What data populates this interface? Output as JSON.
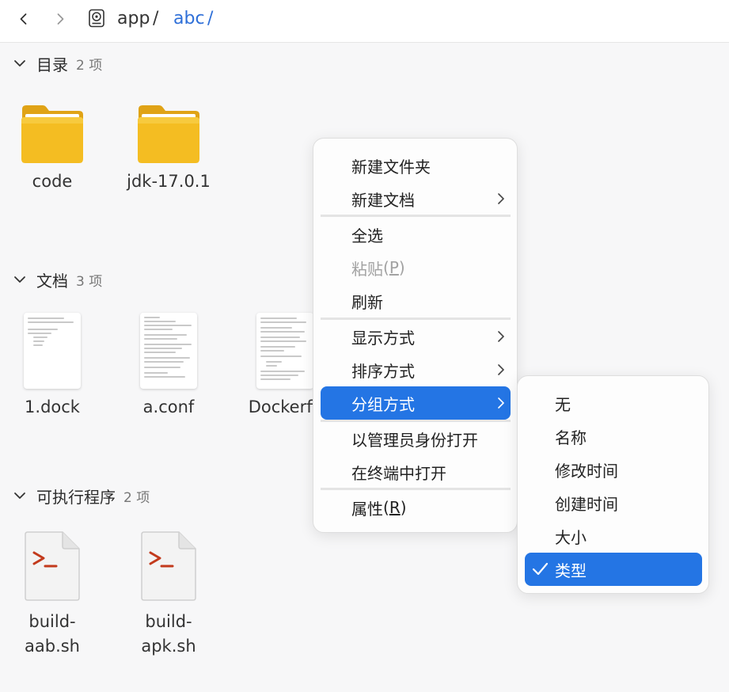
{
  "breadcrumb": {
    "parts": [
      "app",
      "abc"
    ],
    "separator": "/"
  },
  "sections": [
    {
      "title": "目录",
      "count": "2 项",
      "items": [
        "code",
        "jdk-17.0.1"
      ]
    },
    {
      "title": "文档",
      "count": "3 项",
      "items": [
        "1.dock",
        "a.conf",
        "Dockerfil"
      ]
    },
    {
      "title": "可执行程序",
      "count": "2 项",
      "items": [
        "build-\naab.sh",
        "build-\napk.sh"
      ]
    }
  ],
  "context_menu": {
    "new_folder": "新建文件夹",
    "new_document": "新建文档",
    "select_all": "全选",
    "paste": "粘贴",
    "paste_key": "P",
    "refresh": "刷新",
    "view_mode": "显示方式",
    "sort_by": "排序方式",
    "group_by": "分组方式",
    "open_as_admin": "以管理员身份打开",
    "open_in_terminal": "在终端中打开",
    "properties": "属性",
    "properties_key": "R"
  },
  "group_submenu": {
    "items": [
      "无",
      "名称",
      "修改时间",
      "创建时间",
      "大小",
      "类型"
    ],
    "selected": "类型"
  },
  "colors": {
    "accent": "#2475e4",
    "folder": "#f2b81f",
    "script_prompt": "#c23a1c",
    "link": "#2e6fd8"
  },
  "icons": {
    "back": "chevron-left-icon",
    "forward": "chevron-right-icon",
    "drive": "drive-icon",
    "collapse": "chevron-down-icon",
    "folder": "folder-icon",
    "document": "document-thumbnail",
    "script": "terminal-script-icon",
    "submenu": "chevron-right-icon",
    "check": "check-icon"
  }
}
